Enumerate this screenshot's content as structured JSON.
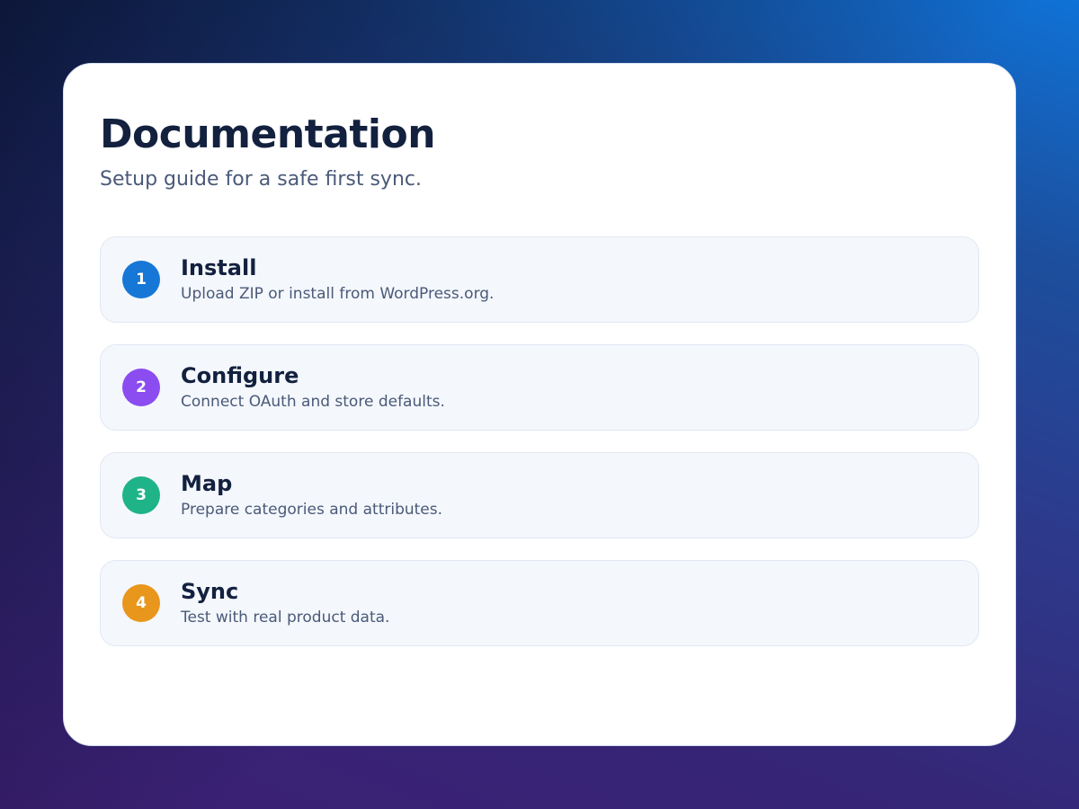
{
  "header": {
    "title": "Documentation",
    "subtitle": "Setup guide for a safe first sync."
  },
  "steps": [
    {
      "number": "1",
      "title": "Install",
      "description": "Upload ZIP or install from WordPress.org.",
      "color": "#1677d6"
    },
    {
      "number": "2",
      "title": "Configure",
      "description": "Connect OAuth and store defaults.",
      "color": "#8b4cf0"
    },
    {
      "number": "3",
      "title": "Map",
      "description": "Prepare categories and attributes.",
      "color": "#1fb388"
    },
    {
      "number": "4",
      "title": "Sync",
      "description": "Test with real product data.",
      "color": "#e8961c"
    }
  ]
}
